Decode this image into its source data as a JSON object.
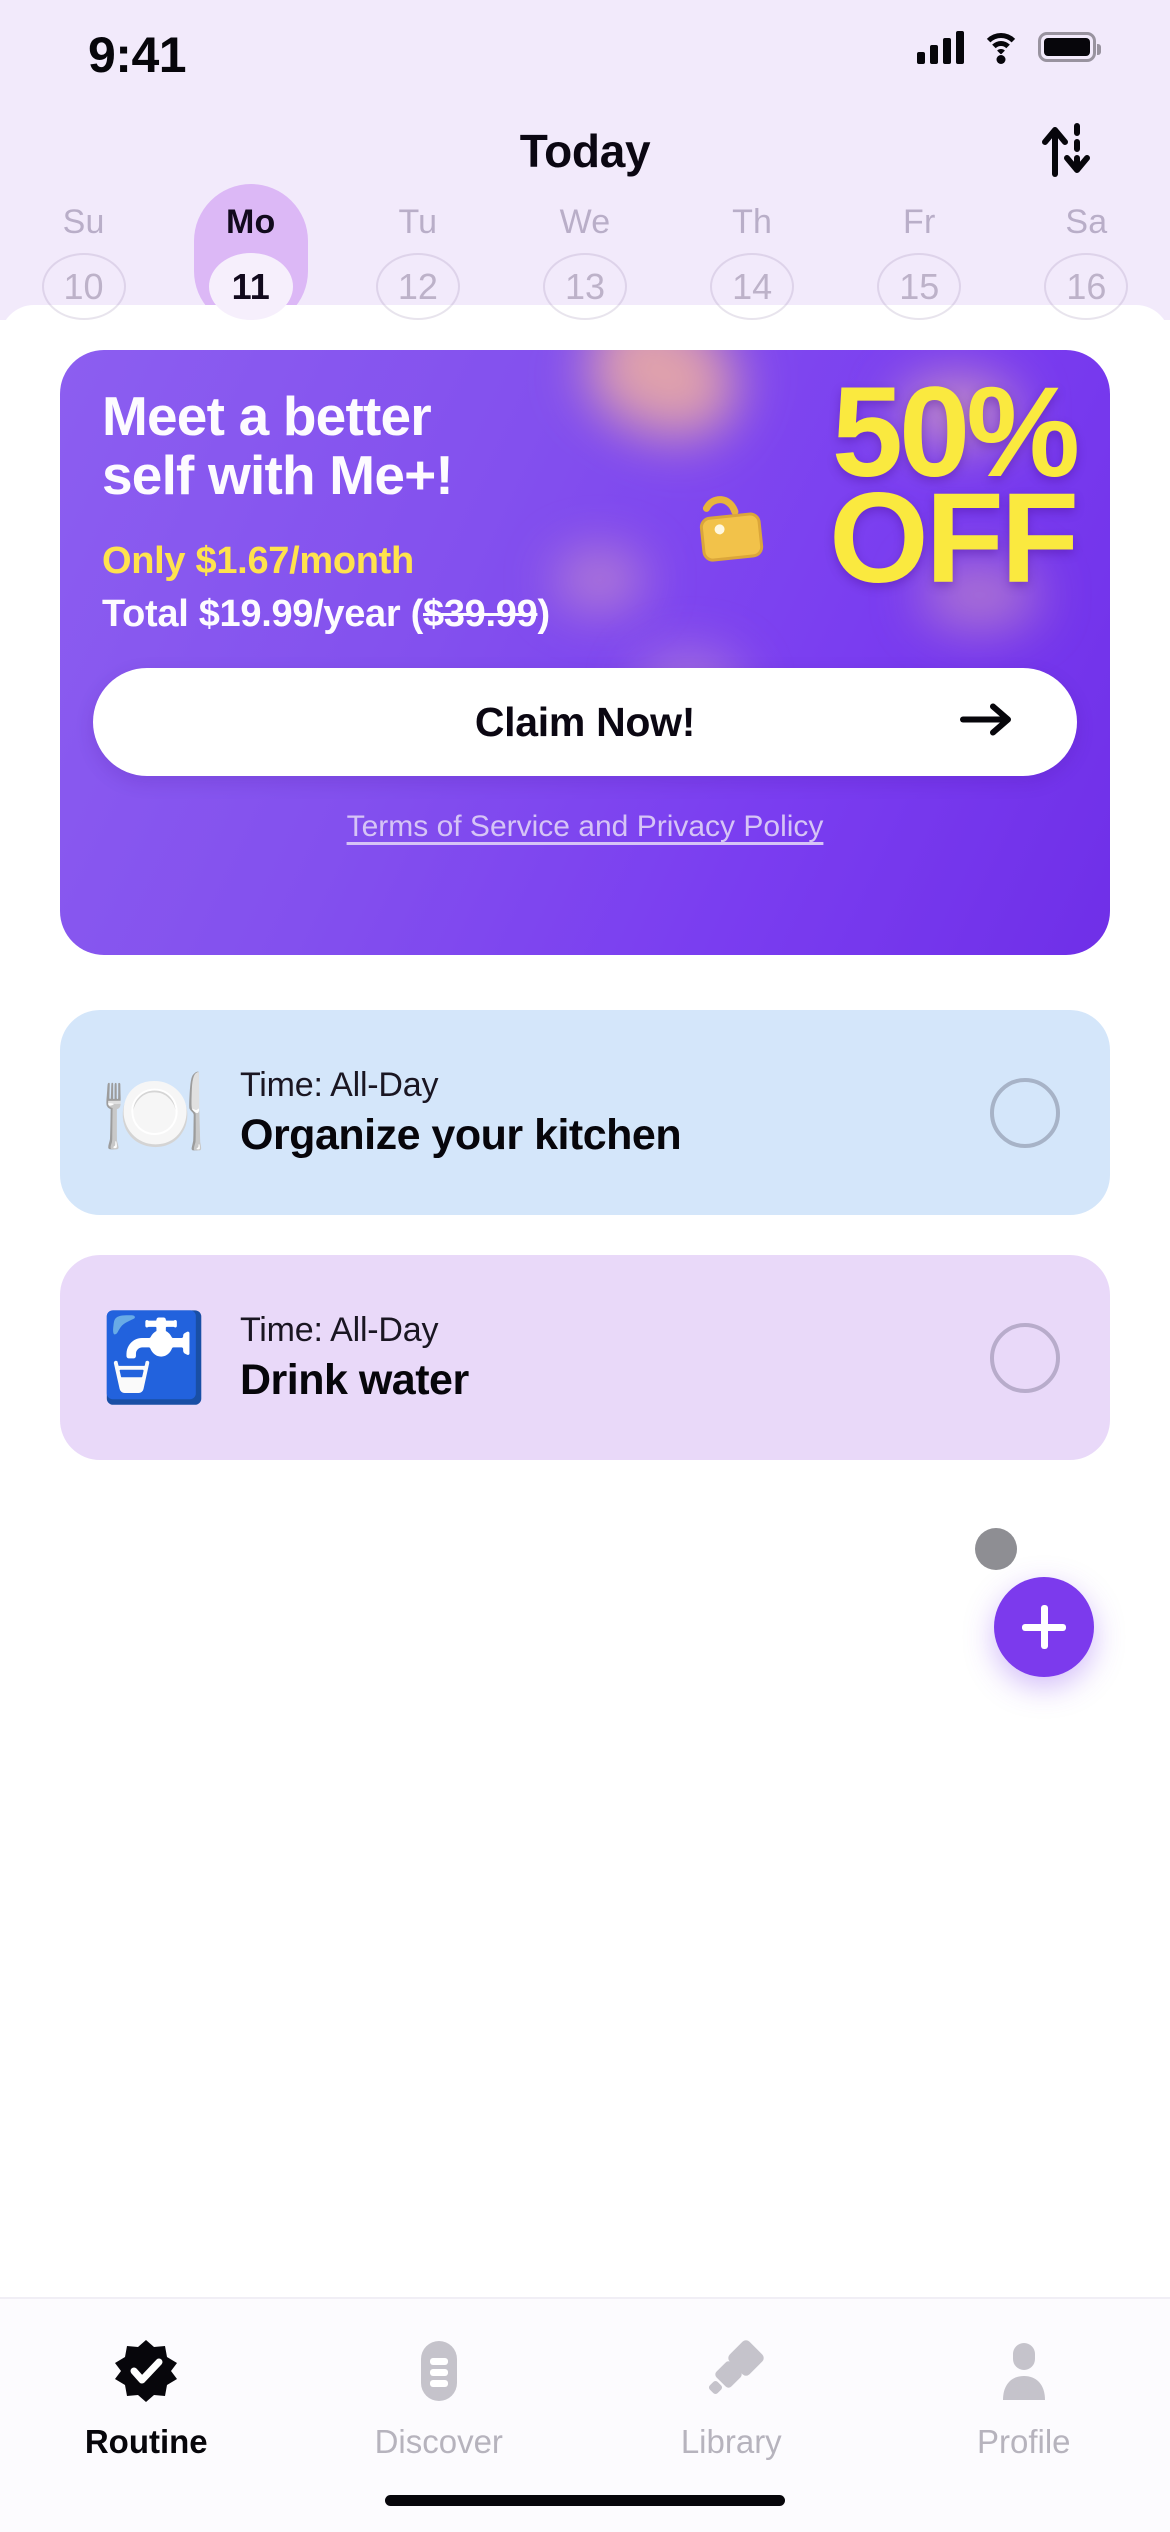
{
  "status_bar": {
    "time": "9:41",
    "cellular_icon": "cellular-signal-icon",
    "wifi_icon": "wifi-icon",
    "battery_icon": "battery-icon"
  },
  "nav": {
    "title": "Today",
    "sort_icon": "sort-arrows-icon"
  },
  "week_strip": {
    "days": [
      {
        "dow": "Su",
        "date": "10",
        "selected": false
      },
      {
        "dow": "Mo",
        "date": "11",
        "selected": true
      },
      {
        "dow": "Tu",
        "date": "12",
        "selected": false
      },
      {
        "dow": "We",
        "date": "13",
        "selected": false
      },
      {
        "dow": "Th",
        "date": "14",
        "selected": false
      },
      {
        "dow": "Fr",
        "date": "15",
        "selected": false
      },
      {
        "dow": "Sa",
        "date": "16",
        "selected": false
      }
    ]
  },
  "promo": {
    "headline_line1": "Meet a better",
    "headline_line2": "self with Me+!",
    "price_monthly": "Only $1.67/month",
    "price_total_prefix": "Total $19.99/year (",
    "price_old": "$39.99",
    "price_total_suffix": ")",
    "discount_percent": "50%",
    "discount_word": "OFF",
    "cta_label": "Claim Now!",
    "cta_arrow_icon": "arrow-right-icon",
    "tag_icon": "price-tag-icon",
    "terms_label": "Terms of Service and Privacy Policy",
    "accent_yellow": "#fae93f",
    "bg_purple": "#7a3df0"
  },
  "tasks": [
    {
      "emoji": "🍽️",
      "emoji_name": "plate-fork-knife-icon",
      "time": "Time: All-Day",
      "title": "Organize your kitchen",
      "checked": false,
      "bg": "#d4e6fa"
    },
    {
      "emoji": "🚰",
      "emoji_name": "potable-water-tap-icon",
      "time": "Time: All-Day",
      "title": "Drink water",
      "checked": false,
      "bg": "#e9d9f9"
    }
  ],
  "fab": {
    "add_icon": "plus-icon",
    "secondary_dot_icon": "small-circle-icon",
    "color": "#7c3aed"
  },
  "tab_bar": {
    "items": [
      {
        "label": "Routine",
        "icon": "badge-check-icon",
        "active": true
      },
      {
        "label": "Discover",
        "icon": "list-capsule-icon",
        "active": false
      },
      {
        "label": "Library",
        "icon": "diamonds-icon",
        "active": false
      },
      {
        "label": "Profile",
        "icon": "person-icon",
        "active": false
      }
    ]
  }
}
